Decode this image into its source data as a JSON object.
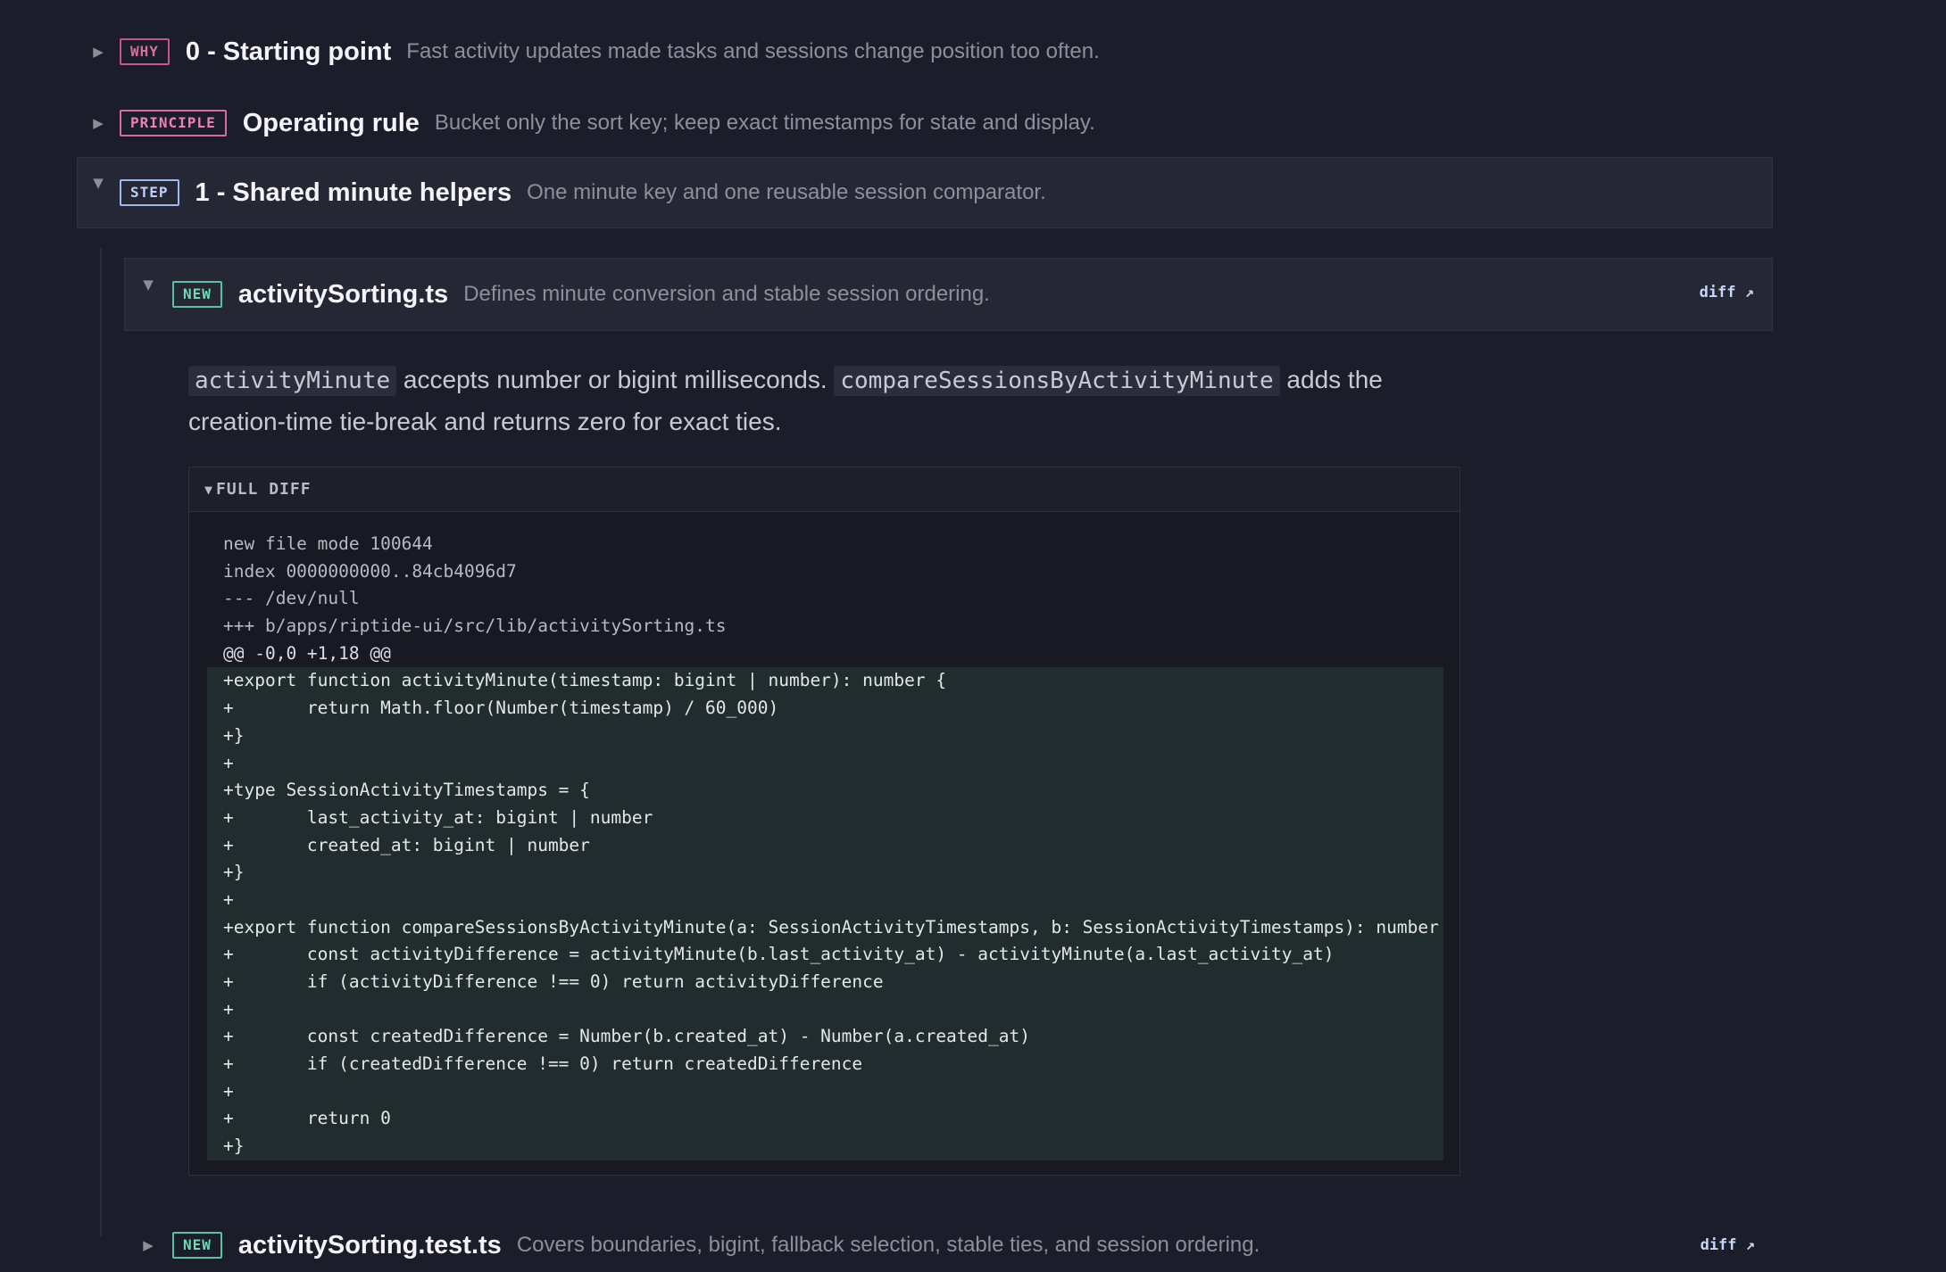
{
  "rows": {
    "why": {
      "badge": "WHY",
      "title": "0 - Starting point",
      "subtitle": "Fast activity updates made tasks and sessions change position too often."
    },
    "principle": {
      "badge": "PRINCIPLE",
      "title": "Operating rule",
      "subtitle": "Bucket only the sort key; keep exact timestamps for state and display."
    },
    "step": {
      "badge": "STEP",
      "title": "1 - Shared minute helpers",
      "subtitle": "One minute key and one reusable session comparator."
    }
  },
  "file": {
    "badge": "NEW",
    "title": "activitySorting.ts",
    "subtitle": "Defines minute conversion and stable session ordering.",
    "diff_link": "diff ↗",
    "desc_code1": "activityMinute",
    "desc_text1": " accepts number or bigint milliseconds. ",
    "desc_code2": "compareSessionsByActivityMinute",
    "desc_text2": " adds the creation-time tie-break and returns zero for exact ties."
  },
  "diff": {
    "header": "FULL DIFF",
    "lines": [
      {
        "t": "meta",
        "s": "new file mode 100644"
      },
      {
        "t": "meta",
        "s": "index 0000000000..84cb4096d7"
      },
      {
        "t": "meta",
        "s": "--- /dev/null"
      },
      {
        "t": "meta",
        "s": "+++ b/apps/riptide-ui/src/lib/activitySorting.ts"
      },
      {
        "t": "hunk",
        "s": "@@ -0,0 +1,18 @@"
      },
      {
        "t": "add",
        "s": "+export function activityMinute(timestamp: bigint | number): number {"
      },
      {
        "t": "add",
        "s": "+       return Math.floor(Number(timestamp) / 60_000)"
      },
      {
        "t": "add",
        "s": "+}"
      },
      {
        "t": "add",
        "s": "+"
      },
      {
        "t": "add",
        "s": "+type SessionActivityTimestamps = {"
      },
      {
        "t": "add",
        "s": "+       last_activity_at: bigint | number"
      },
      {
        "t": "add",
        "s": "+       created_at: bigint | number"
      },
      {
        "t": "add",
        "s": "+}"
      },
      {
        "t": "add",
        "s": "+"
      },
      {
        "t": "add",
        "s": "+export function compareSessionsByActivityMinute(a: SessionActivityTimestamps, b: SessionActivityTimestamps): number {"
      },
      {
        "t": "add",
        "s": "+       const activityDifference = activityMinute(b.last_activity_at) - activityMinute(a.last_activity_at)"
      },
      {
        "t": "add",
        "s": "+       if (activityDifference !== 0) return activityDifference"
      },
      {
        "t": "add",
        "s": "+"
      },
      {
        "t": "add",
        "s": "+       const createdDifference = Number(b.created_at) - Number(a.created_at)"
      },
      {
        "t": "add",
        "s": "+       if (createdDifference !== 0) return createdDifference"
      },
      {
        "t": "add",
        "s": "+"
      },
      {
        "t": "add",
        "s": "+       return 0"
      },
      {
        "t": "add",
        "s": "+}"
      }
    ]
  },
  "next_file": {
    "badge": "NEW",
    "title": "activitySorting.test.ts",
    "subtitle": "Covers boundaries, bigint, fallback selection, stable ties, and session ordering.",
    "diff_link": "diff ↗"
  },
  "icons": {
    "collapsed": "triangle-right",
    "expanded": "triangle-down"
  },
  "colors": {
    "background": "#1c1d2a",
    "panel": "#262735",
    "added_line": "#212c2e",
    "badge_why": "#d770a0",
    "badge_step": "#bcd3ff",
    "badge_new": "#6fd8b4"
  }
}
